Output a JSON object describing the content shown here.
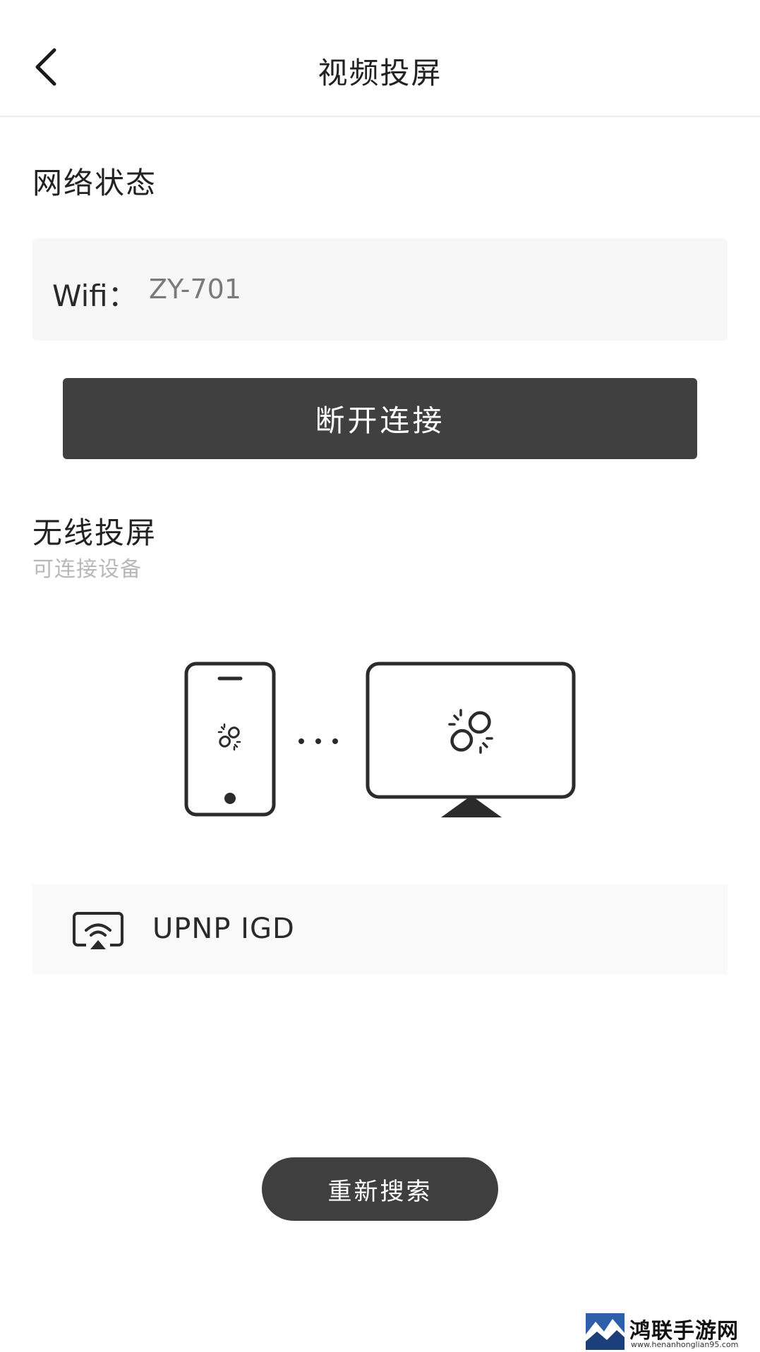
{
  "header": {
    "title": "视频投屏",
    "back_icon": "chevron-left-icon"
  },
  "network": {
    "section_title": "网络状态",
    "wifi_label": "Wifi：",
    "wifi_value": "ZY-701",
    "disconnect_label": "断开连接"
  },
  "cast": {
    "section_title": "无线投屏",
    "subtitle": "可连接设备",
    "illustration": {
      "phone_icon": "phone-icon",
      "tv_icon": "monitor-icon",
      "link_icon": "broken-link-icon"
    },
    "devices": [
      {
        "icon": "airplay-wifi-icon",
        "name": "UPNP IGD"
      }
    ],
    "research_label": "重新搜索"
  },
  "watermark": {
    "name": "鸿联手游网",
    "url": "www.henanhonglian95.com"
  },
  "colors": {
    "primary_button": "#404040",
    "background": "#ffffff",
    "panel": "#f7f7f7",
    "muted_text": "#b8b8b8"
  }
}
